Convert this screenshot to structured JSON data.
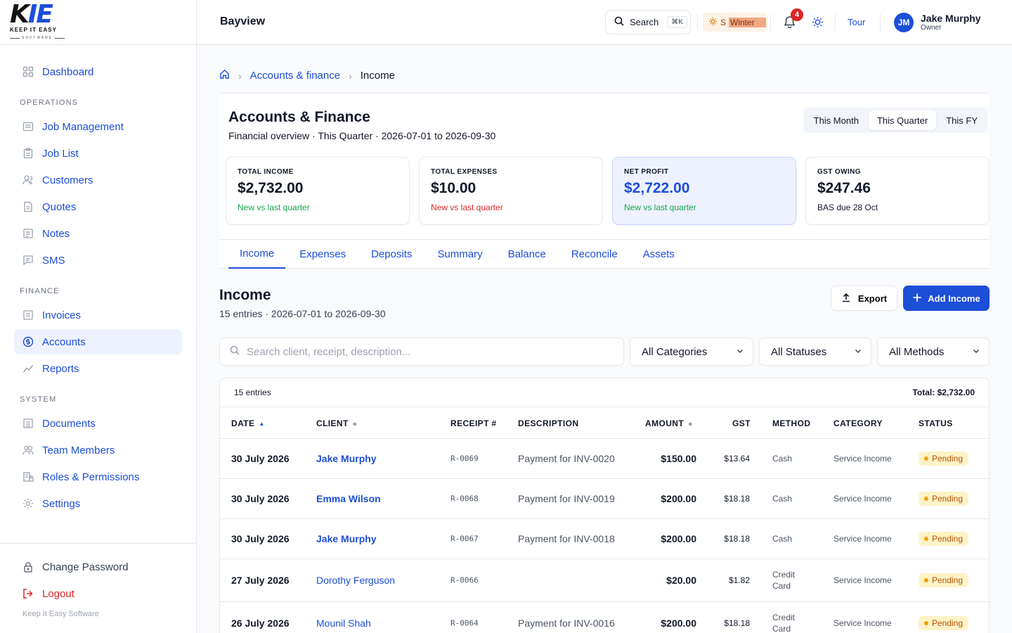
{
  "brand": {
    "mark_k": "K",
    "mark_ie": "IE",
    "tagline": "KEEP IT EASY",
    "software": "SOFTWARE"
  },
  "sidebar": {
    "dashboard": {
      "label": "Dashboard",
      "icon": "grid-icon"
    },
    "sections": [
      {
        "title": "OPERATIONS",
        "items": [
          {
            "label": "Job Management",
            "icon": "briefcase-icon"
          },
          {
            "label": "Job List",
            "icon": "clipboard-icon"
          },
          {
            "label": "Customers",
            "icon": "user-icon"
          },
          {
            "label": "Quotes",
            "icon": "document-icon"
          },
          {
            "label": "Notes",
            "icon": "note-icon"
          },
          {
            "label": "SMS",
            "icon": "message-icon"
          }
        ]
      },
      {
        "title": "FINANCE",
        "items": [
          {
            "label": "Invoices",
            "icon": "invoice-icon"
          },
          {
            "label": "Accounts",
            "icon": "dollar-circle-icon",
            "active": true
          },
          {
            "label": "Reports",
            "icon": "trend-icon"
          }
        ]
      },
      {
        "title": "SYSTEM",
        "items": [
          {
            "label": "Documents",
            "icon": "document-icon"
          },
          {
            "label": "Team Members",
            "icon": "team-icon"
          },
          {
            "label": "Roles & Permissions",
            "icon": "building-lock-icon"
          },
          {
            "label": "Settings",
            "icon": "gear-icon"
          }
        ]
      }
    ],
    "change_password": "Change Password",
    "logout": "Logout",
    "footer": "Keep It Easy Software"
  },
  "header": {
    "org": "Bayview",
    "search_label": "Search",
    "search_shortcut": "⌘K",
    "season_prefix": "S",
    "season_label": "Winter",
    "notification_count": "4",
    "tour": "Tour",
    "user": {
      "initials": "JM",
      "name": "Jake Murphy",
      "role": "Owner"
    }
  },
  "breadcrumb": {
    "parent": "Accounts & finance",
    "current": "Income"
  },
  "overview": {
    "title": "Accounts & Finance",
    "subtitle": "Financial overview · This Quarter · 2026-07-01 to 2026-09-30",
    "periods": [
      "This Month",
      "This Quarter",
      "This FY"
    ],
    "active_period": "This Quarter",
    "cards": [
      {
        "label": "TOTAL INCOME",
        "value": "$2,732.00",
        "note": "New vs last quarter",
        "note_color": "#16a34a"
      },
      {
        "label": "TOTAL EXPENSES",
        "value": "$10.00",
        "note": "New vs last quarter",
        "note_color": "#dc2626"
      },
      {
        "label": "NET PROFIT",
        "value": "$2,722.00",
        "note": "New vs last quarter",
        "note_color": "#16a34a"
      },
      {
        "label": "GST OWING",
        "value": "$247.46",
        "note": "BAS due 28 Oct",
        "note_color": "#111827"
      }
    ]
  },
  "tabs": [
    "Income",
    "Expenses",
    "Deposits",
    "Summary",
    "Balance",
    "Reconcile",
    "Assets"
  ],
  "active_tab": "Income",
  "income": {
    "title": "Income",
    "subtitle": "15 entries · 2026-07-01 to 2026-09-30",
    "export_label": "Export",
    "add_label": "Add Income",
    "search_placeholder": "Search client, receipt, description...",
    "filters": {
      "category": "All Categories",
      "status": "All Statuses",
      "method": "All Methods"
    },
    "table": {
      "count_label": "15 entries",
      "total_prefix": "Total:",
      "total_value": "$2,732.00",
      "headers": {
        "date": "DATE",
        "client": "CLIENT",
        "receipt": "RECEIPT #",
        "description": "DESCRIPTION",
        "amount": "AMOUNT",
        "gst": "GST",
        "method": "METHOD",
        "category": "CATEGORY",
        "status": "STATUS"
      },
      "rows": [
        {
          "date": "30 July 2026",
          "client": "Jake Murphy",
          "receipt": "R-0069",
          "description": "Payment for INV-0020",
          "amount": "$150.00",
          "gst": "$13.64",
          "method": "Cash",
          "category": "Service Income",
          "status": "Pending"
        },
        {
          "date": "30 July 2026",
          "client": "Emma Wilson",
          "receipt": "R-0068",
          "description": "Payment for INV-0019",
          "amount": "$200.00",
          "gst": "$18.18",
          "method": "Cash",
          "category": "Service Income",
          "status": "Pending"
        },
        {
          "date": "30 July 2026",
          "client": "Jake Murphy",
          "receipt": "R-0067",
          "description": "Payment for INV-0018",
          "amount": "$200.00",
          "gst": "$18.18",
          "method": "Cash",
          "category": "Service Income",
          "status": "Pending"
        },
        {
          "date": "27 July 2026",
          "client": "Dorothy Ferguson",
          "receipt": "R-0066",
          "description": "",
          "amount": "$20.00",
          "gst": "$1.82",
          "method": "Credit Card",
          "category": "Service Income",
          "status": "Pending"
        },
        {
          "date": "26 July 2026",
          "client": "Mounil Shah",
          "receipt": "R-0064",
          "description": "Payment for INV-0016",
          "amount": "$200.00",
          "gst": "$18.18",
          "method": "Credit Card",
          "category": "Service Income",
          "status": "Pending"
        }
      ]
    }
  }
}
